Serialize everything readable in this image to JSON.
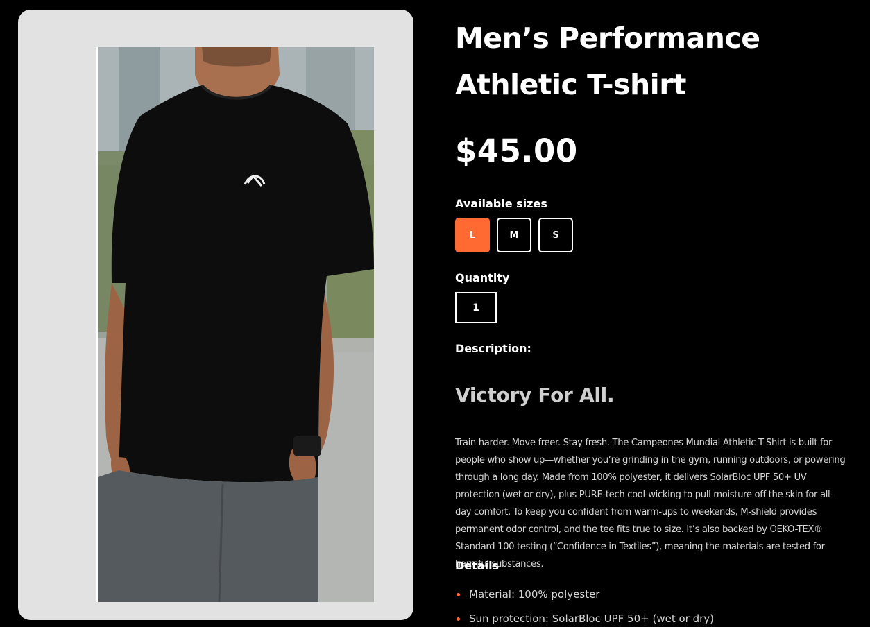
{
  "product": {
    "title": "Men’s Performance Athletic T-shirt",
    "price": "$45.00",
    "image_alt": "Man wearing black athletic t-shirt"
  },
  "sizes": {
    "label": "Available sizes",
    "options": [
      "L",
      "M",
      "S"
    ],
    "selected": "L"
  },
  "quantity": {
    "label": "Quantity",
    "value": "1"
  },
  "description": {
    "label": "Description:",
    "tagline": "Victory For All.",
    "body": "Train harder. Move freer. Stay fresh. The Campeones Mundial Athletic T-Shirt is built for people who show up—whether you’re grinding in the gym, running outdoors, or powering through a long day. Made from 100% polyester, it delivers SolarBloc UPF 50+ UV protection (wet or dry), plus PURE-tech cool-wicking to pull moisture off the skin for all-day comfort. To keep you confident from warm-ups to weekends, M-shield provides permanent odor control, and the tee fits true to size. It’s also backed by OEKO-TEX® Standard 100 testing (“Confidence in Textiles”), meaning the materials are tested for harmful substances."
  },
  "details": {
    "label": "Details",
    "items": [
      "Material: 100% polyester",
      "Sun protection: SolarBloc UPF 50+ (wet or dry)"
    ]
  },
  "colors": {
    "accent": "#ff6a33",
    "background": "#000000",
    "card": "#e2e2e2"
  }
}
